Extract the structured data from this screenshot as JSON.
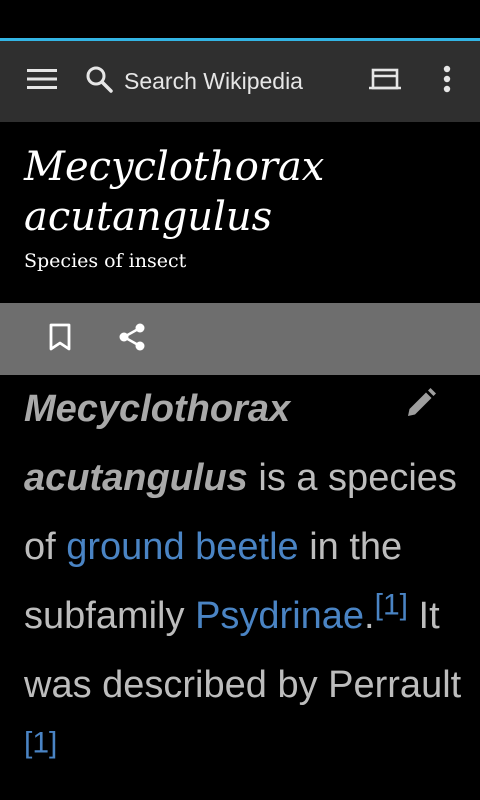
{
  "toolbar": {
    "search_placeholder": "Search Wikipedia",
    "accent_color": "#33b5e5",
    "icons": [
      "menu-icon",
      "search-icon",
      "tabs-icon",
      "more-vert-icon"
    ]
  },
  "article": {
    "title": "Mecyclothorax acutangulus",
    "description": "Species of insect",
    "actions": [
      "bookmark-icon",
      "share-icon"
    ],
    "edit_icon": "pencil-icon",
    "intro": {
      "subject": "Mecyclothorax acutangulus",
      "text1": " is a species of ",
      "link1": "ground beetle",
      "text2": " in the subfamily ",
      "link2": "Psydrinae",
      "text3": ".",
      "ref1": "[1]",
      "text4": " It was described by Perrault",
      "text5": " ",
      "ref2": "[1]"
    },
    "link_color": "#4a84c4"
  }
}
